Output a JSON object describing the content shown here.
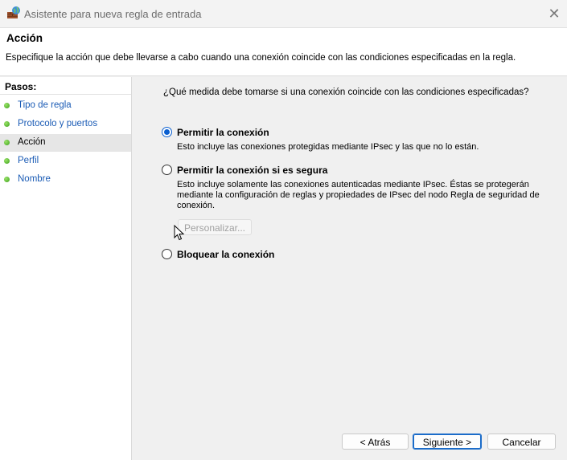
{
  "window": {
    "title": "Asistente para nueva regla de entrada",
    "app_icon": "firewall-icon",
    "close_icon": "close-icon"
  },
  "header": {
    "title": "Acción",
    "description": "Especifique la acción que debe llevarse a cabo cuando una conexión coincide con las condiciones especificadas en la regla."
  },
  "steps": {
    "label": "Pasos:",
    "items": [
      {
        "label": "Tipo de regla"
      },
      {
        "label": "Protocolo y puertos"
      },
      {
        "label": "Acción"
      },
      {
        "label": "Perfil"
      },
      {
        "label": "Nombre"
      }
    ],
    "current_index": 2
  },
  "main": {
    "question": "¿Qué medida debe tomarse si una conexión coincide con las condiciones especificadas?",
    "options": [
      {
        "label": "Permitir la conexión",
        "description": "Esto incluye las conexiones protegidas mediante IPsec y las que no lo están.",
        "selected": true
      },
      {
        "label": "Permitir la conexión si es segura",
        "description_lines": [
          "Esto incluye solamente las conexiones autenticadas mediante IPsec. Éstas se protegerán",
          "mediante la configuración de reglas y propiedades de IPsec del nodo Regla de seguridad de",
          "conexión."
        ],
        "selected": false
      },
      {
        "label": "Bloquear la conexión",
        "selected": false
      }
    ],
    "customize_label": "Personalizar..."
  },
  "footer": {
    "back_label": "< Atrás",
    "next_label": "Siguiente >",
    "cancel_label": "Cancelar"
  },
  "colors": {
    "accent": "#0a5fd0",
    "link": "#1a5bb5",
    "step_dot": "#3aa018"
  }
}
